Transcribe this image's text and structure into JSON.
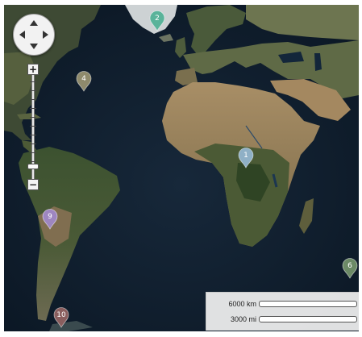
{
  "map": {
    "zoom_control": {
      "zoom_in": "+",
      "zoom_out": "−",
      "level_fraction": 0.1
    },
    "pins": [
      {
        "label": "1",
        "color": "#8fb0c6"
      },
      {
        "label": "2",
        "color": "#5ab39a"
      },
      {
        "label": "4",
        "color": "#8e8a6c"
      },
      {
        "label": "6",
        "color": "#6c8a66"
      },
      {
        "label": "9",
        "color": "#9e86c0"
      },
      {
        "label": "10",
        "color": "#8a5e5e"
      }
    ],
    "scale_bar": {
      "metric": "6000 km",
      "imperial": "3000 mi"
    }
  }
}
